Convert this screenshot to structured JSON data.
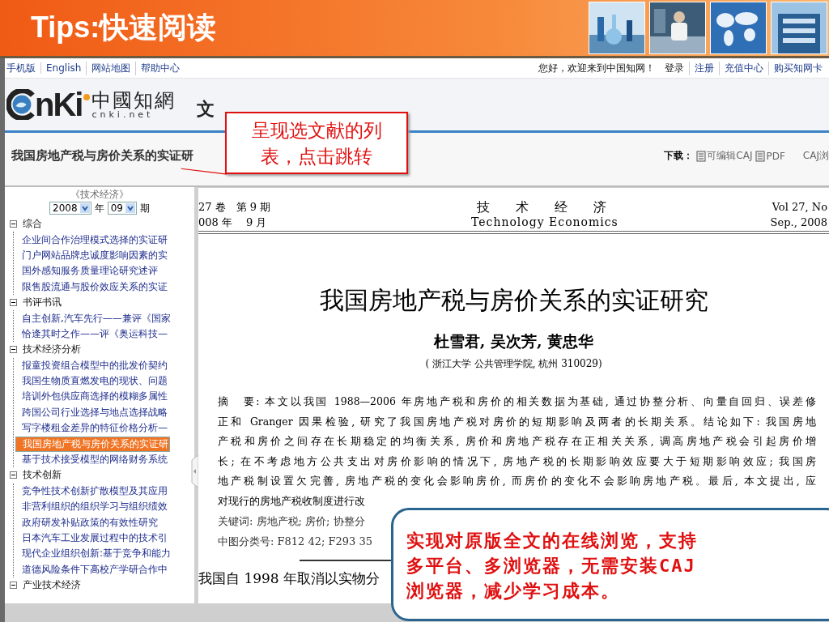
{
  "slide": {
    "title": "Tips:快速阅读"
  },
  "top_nav": {
    "left_links": [
      "手机版",
      "English",
      "网站地图",
      "帮助中心"
    ],
    "greeting": "您好，欢迎来到中国知网！",
    "right_links": [
      "登录",
      "注册",
      "充值中心",
      "购买知网卡"
    ]
  },
  "logo": {
    "letters": "nKi",
    "chinese": "中國知網",
    "domain": "cnki.net",
    "heading": "文"
  },
  "article_bar": {
    "title": "我国房地产税与房价关系的实证研",
    "download_label": "下载：",
    "downloads": [
      "可编辑CAJ",
      "PDF"
    ],
    "viewer": "CAJ浏"
  },
  "sidebar": {
    "journal": "《技术经济》",
    "year": "2008",
    "year_label": "年",
    "issue": "09",
    "issue_label": "期",
    "tree": [
      {
        "label": "综合",
        "expanded": true,
        "children": [
          {
            "label": "企业间合作治理模式选择的实证研",
            "selected": false
          },
          {
            "label": "门户网站品牌忠诚度影响因素的实",
            "selected": false
          },
          {
            "label": "国外感知服务质量理论研究述评",
            "selected": false
          },
          {
            "label": "限售股流通与股价效应关系的实证",
            "selected": false
          }
        ]
      },
      {
        "label": "书评书讯",
        "expanded": true,
        "children": [
          {
            "label": "自主创新,汽车先行——兼评《国家",
            "selected": false
          },
          {
            "label": "恰逢其时之作——评《奥运科技—",
            "selected": false
          }
        ]
      },
      {
        "label": "技术经济分析",
        "expanded": true,
        "children": [
          {
            "label": "报童投资组合模型中的批发价契约",
            "selected": false
          },
          {
            "label": "我国生物质直燃发电的现状、问题",
            "selected": false
          },
          {
            "label": "培训外包供应商选择的模糊多属性",
            "selected": false
          },
          {
            "label": "跨国公司行业选择与地点选择战略",
            "selected": false
          },
          {
            "label": "写字楼租金差异的特征价格分析—",
            "selected": false
          },
          {
            "label": "我国房地产税与房价关系的实证研",
            "selected": true
          },
          {
            "label": "基于技术接受模型的网络财务系统",
            "selected": false
          }
        ]
      },
      {
        "label": "技术创新",
        "expanded": true,
        "children": [
          {
            "label": "竞争性技术创新扩散模型及其应用",
            "selected": false
          },
          {
            "label": "非营利组织的组织学习与组织绩效",
            "selected": false
          },
          {
            "label": "政府研发补贴政策的有效性研究",
            "selected": false
          },
          {
            "label": "日本汽车工业发展过程中的技术引",
            "selected": false
          },
          {
            "label": "现代企业组织创新:基于竞争和能力",
            "selected": false
          },
          {
            "label": "道德风险条件下高校产学研合作中",
            "selected": false
          }
        ]
      },
      {
        "label": "产业技术经济",
        "expanded": true
      }
    ]
  },
  "document": {
    "volume": "27 卷　第 9 期",
    "date": "008 年　 9 月",
    "journal_cn": "技　术　经　济",
    "journal_en": "Technology Economics",
    "vol_en": "Vol 27, No",
    "date_en": "Sep., 2008",
    "title": "我国房地产税与房价关系的实证研究",
    "authors": "杜雪君, 吴次芳, 黄忠华",
    "affiliation": "( 浙江大学 公共管理学院, 杭州 310029)",
    "abstract_lines": [
      "摘　要: 本文以我国 1988—2006 年房地产税和房价的相关数据为基础, 通过协整分析、向量自回归、误差修",
      "正和 Granger 因果检验, 研究了我国房地产税对房价的短期影响及两者的长期关系。结论如下: 我国房地",
      "产税和房价之间存在长期稳定的均衡关系, 房价和房地产税存在正相关关系, 调高房地产税会引起房价增",
      "长; 在不考虑地方公共支出对房价影响的情况下, 房地产税的长期影响效应要大于短期影响效应; 我国房",
      "地产税制设置欠完善, 房地产税的变化会影响房价, 而房价的变化不会影响房地产税。最后, 本文提出, 应",
      "对现行的房地产税收制度进行改"
    ],
    "keywords": "关键词: 房地产税; 房价; 协整分",
    "classification": "中图分类号: F812 42; F293 35",
    "body": "我国自 1998 年取消以实物分"
  },
  "callouts": [
    {
      "text": "呈现选文献的列表，点击跳转"
    },
    {
      "text": "实现对原版全文的在线浏览，支持多平台、多浏览器，无需安装CAJ浏览器，减少学习成本。"
    }
  ]
}
